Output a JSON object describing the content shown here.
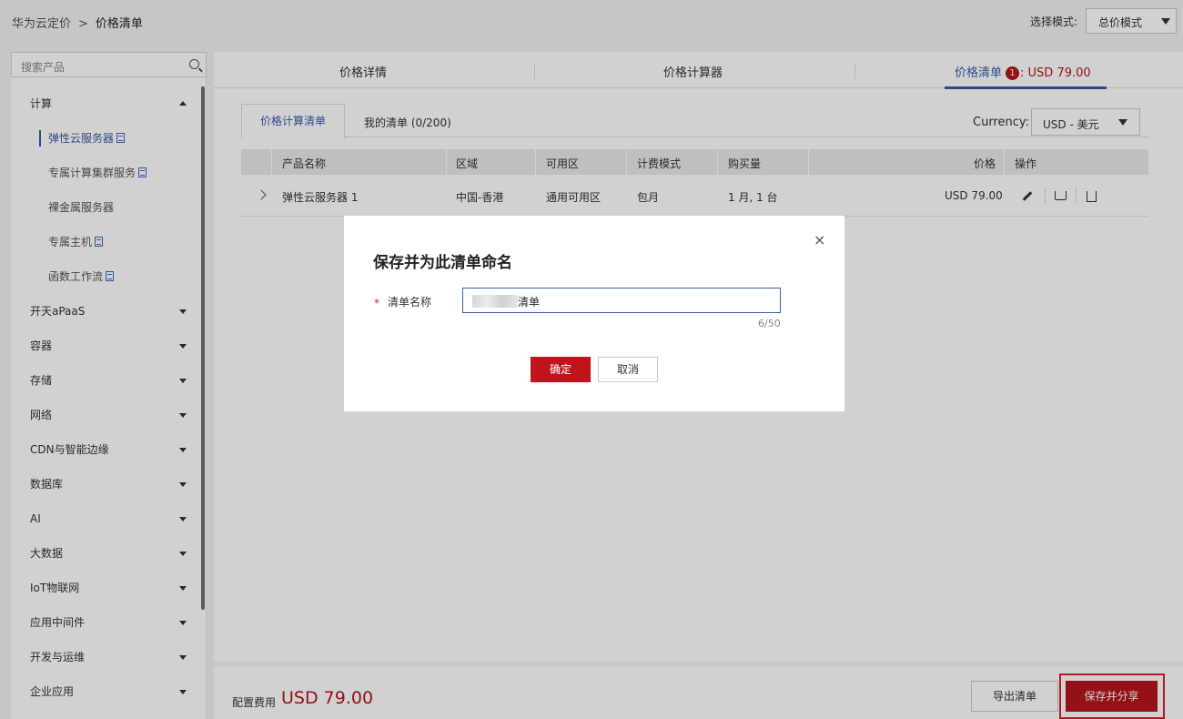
{
  "header": {
    "breadcrumb_root": "华为云定价",
    "breadcrumb_sep": ">",
    "breadcrumb_current": "价格清单",
    "mode_label": "选择模式:",
    "mode_value": "总价模式"
  },
  "sidebar": {
    "search_placeholder": "搜索产品",
    "categories": [
      {
        "label": "计算",
        "expanded": true
      },
      {
        "label": "开天aPaaS"
      },
      {
        "label": "容器"
      },
      {
        "label": "存储"
      },
      {
        "label": "网络"
      },
      {
        "label": "CDN与智能边缘"
      },
      {
        "label": "数据库"
      },
      {
        "label": "AI"
      },
      {
        "label": "大数据"
      },
      {
        "label": "IoT物联网"
      },
      {
        "label": "应用中间件"
      },
      {
        "label": "开发与运维"
      },
      {
        "label": "企业应用"
      }
    ],
    "compute_items": [
      {
        "label": "弹性云服务器",
        "active": true
      },
      {
        "label": "专属计算集群服务"
      },
      {
        "label": "裸金属服务器"
      },
      {
        "label": "专属主机"
      },
      {
        "label": "函数工作流"
      }
    ]
  },
  "topnav": {
    "tab_details": "价格详情",
    "tab_calculator": "价格计算器",
    "tab_list": "价格清单",
    "tab_list_badge": "1",
    "tab_list_price": ": USD 79.00"
  },
  "subtabs": {
    "tab_calc_list": "价格计算清单",
    "tab_my_list": "我的清单 (0/200)",
    "currency_label": "Currency:",
    "currency_value": "USD - 美元"
  },
  "table": {
    "headers": {
      "name": "产品名称",
      "region": "区域",
      "az": "可用区",
      "billing": "计费模式",
      "qty": "购买量",
      "price": "价格",
      "ops": "操作"
    },
    "rows": [
      {
        "name": "弹性云服务器 1",
        "region": "中国-香港",
        "az": "通用可用区",
        "billing": "包月",
        "qty": "1 月, 1 台",
        "price": "USD 79.00"
      }
    ]
  },
  "footer": {
    "cost_label": "配置费用",
    "cost_value": "USD 79.00",
    "export_label": "导出清单",
    "save_share_label": "保存并分享"
  },
  "dialog": {
    "title": "保存并为此清单命名",
    "close": "×",
    "required_mark": "*",
    "field_label": "清单名称",
    "field_value_suffix": "清单",
    "char_count": "6/50",
    "ok_label": "确定",
    "cancel_label": "取消"
  },
  "colors": {
    "accent": "#3b5ba8",
    "brand_red": "#b5151d",
    "highlight": "#d9202b"
  }
}
